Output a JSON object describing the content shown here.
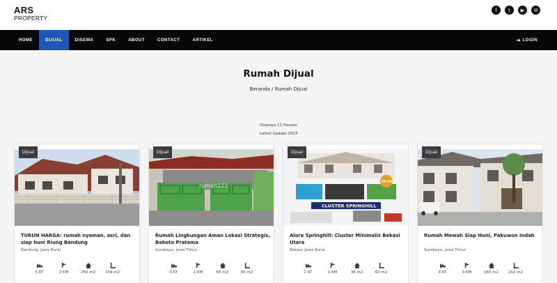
{
  "brand": {
    "name": "ARS",
    "sub": "PROPERTY"
  },
  "socials": [
    {
      "icon": "facebook-icon",
      "glyph": "f"
    },
    {
      "icon": "twitter-icon",
      "glyph": "t"
    },
    {
      "icon": "youtube-icon",
      "glyph": "▶"
    },
    {
      "icon": "email-icon",
      "glyph": "✉"
    }
  ],
  "nav": {
    "items": [
      "HOME",
      "DIJUAL",
      "DISEWA",
      "SPK",
      "ABOUT",
      "CONTACT",
      "ARTIKEL"
    ],
    "active": "DIJUAL",
    "login_label": "LOGIN",
    "login_icon": "login-icon",
    "active_color": "#1f57b6"
  },
  "hero": {
    "title": "Rumah Dijual",
    "breadcrumb": "Beranda / Rumah Dijual"
  },
  "listing_info": {
    "count_text": "Displays 11 Houses",
    "update_text": "Latest Update 2023"
  },
  "stat_icons": [
    "bed-icon",
    "bath-icon",
    "house-icon",
    "land-area-icon"
  ],
  "cards": [
    {
      "badge": "Dijual",
      "title": "TURUN HARGA: rumah nyaman, asri, dan siap huni Riung Bandung",
      "location": "Bandung, Jawa Barat",
      "stats": [
        "5 KT",
        "2 KM",
        "250 m2",
        "159 m2"
      ]
    },
    {
      "badge": "Dijual",
      "title": "Rumah Lingkungan Aman Lokasi Strategis, Babota Pratama",
      "location": "Surabaya, Jawa Timur",
      "stats": [
        "3 KT",
        "1 KM",
        "65 m2",
        "90 m2"
      ]
    },
    {
      "badge": "Dijual",
      "title": "Alora Springhill: Cluster Minimalis Bekasi Utara",
      "location": "Bekasi, Jawa Barat",
      "stats": [
        "2 KT",
        "1 KM",
        "38 m2",
        "60 m2"
      ]
    },
    {
      "badge": "Dijual",
      "title": "Rumah Mewah Siap Huni, Pakuwon Indah",
      "location": "Surabaya, Jawa Timur",
      "stats": [
        "4 KT",
        "4 KM",
        "160 m2",
        "162 m2"
      ]
    }
  ],
  "card_images": {
    "card3_banner_text": "CLUSTER SPRINGHILL",
    "card3_badge_text": "DP 0%",
    "card2_watermark": "rumah123"
  }
}
